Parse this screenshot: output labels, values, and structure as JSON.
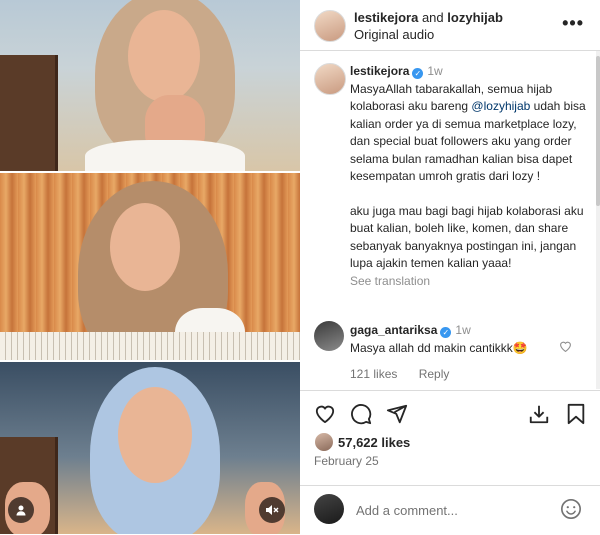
{
  "header": {
    "user1": "lestikejora",
    "joiner": "and",
    "user2": "lozyhijab",
    "audio": "Original audio"
  },
  "caption": {
    "username": "lestikejora",
    "time": "1w",
    "text_start": "MasyaAllah tabarakallah, semua hijab kolaborasi aku bareng",
    "mention": "@lozyhijab",
    "text_end": "udah bisa kalian order ya di semua marketplace lozy, dan special buat followers aku yang order selama bulan ramadhan kalian bisa dapet kesempatan umroh gratis dari lozy !",
    "paragraph2": "aku juga mau bagi bagi hijab kolaborasi aku buat kalian, boleh like, komen, dan share sebanyak banyaknya postingan ini, jangan lupa ajakin temen kalian yaaa!",
    "see_translation": "See translation"
  },
  "comment": {
    "username": "gaga_antariksa",
    "time": "1w",
    "text": "Masya allah dd makin cantikkk🤩",
    "likes": "121 likes",
    "reply": "Reply"
  },
  "post": {
    "likes": "57,622 likes",
    "date": "February 25"
  },
  "composer": {
    "placeholder": "Add a comment..."
  },
  "icons": {
    "more": "more-icon",
    "verified": "verified-badge-icon",
    "heart": "heart-icon",
    "comment": "comment-icon",
    "share": "share-icon",
    "save": "save-icon",
    "download": "download-icon",
    "emoji": "emoji-icon",
    "mute": "mute-icon",
    "user": "user-icon"
  },
  "colors": {
    "verified": "#3897f0",
    "mention": "#00376b",
    "muted": "#737373",
    "border": "#dbdbdb"
  }
}
